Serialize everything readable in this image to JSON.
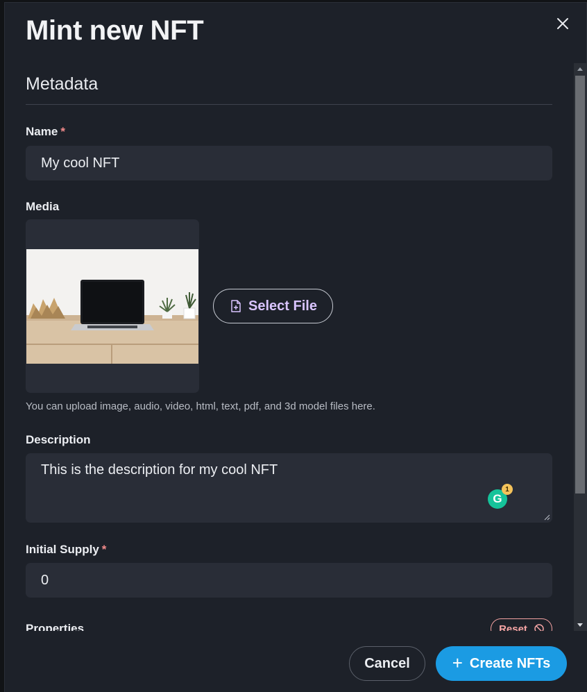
{
  "modal": {
    "title": "Mint new NFT"
  },
  "form": {
    "section_title": "Metadata",
    "name": {
      "label": "Name",
      "required_mark": "*",
      "value": "My cool NFT"
    },
    "media": {
      "label": "Media",
      "select_file_label": "Select File",
      "helper_text": "You can upload image, audio, video, html, text, pdf, and 3d model files here."
    },
    "description": {
      "label": "Description",
      "value": "This is the description for my cool NFT"
    },
    "initial_supply": {
      "label": "Initial Supply",
      "required_mark": "*",
      "value": "0"
    },
    "properties": {
      "label": "Properties",
      "reset_label": "Reset"
    }
  },
  "grammarly": {
    "count": "1",
    "letter": "G"
  },
  "footer": {
    "cancel_label": "Cancel",
    "create_label": "Create NFTs",
    "create_icon": "+"
  },
  "colors": {
    "background": "#1d2129",
    "input": "#292d37",
    "accent": "#1b9be3",
    "required": "#f38b8b",
    "select_file_text": "#d9c4ff"
  }
}
